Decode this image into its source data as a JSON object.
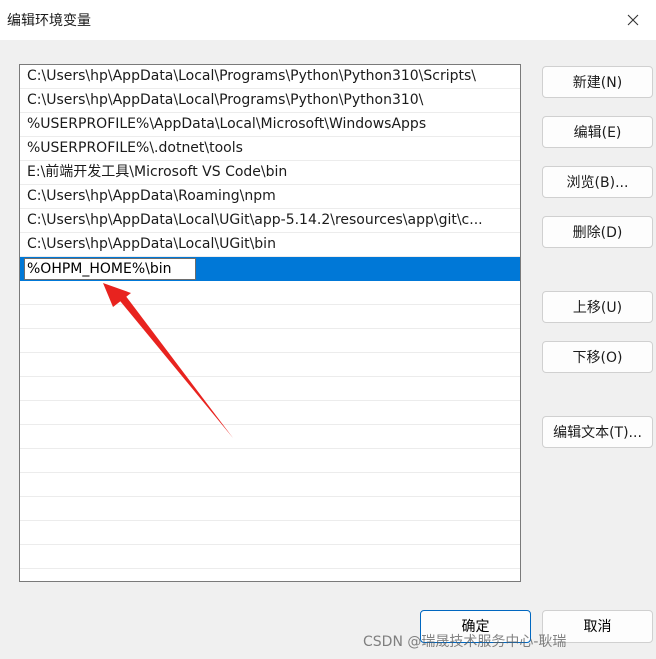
{
  "window": {
    "title": "编辑环境变量"
  },
  "list": {
    "items": [
      "C:\\Users\\hp\\AppData\\Local\\Programs\\Python\\Python310\\Scripts\\",
      "C:\\Users\\hp\\AppData\\Local\\Programs\\Python\\Python310\\",
      "%USERPROFILE%\\AppData\\Local\\Microsoft\\WindowsApps",
      "%USERPROFILE%\\.dotnet\\tools",
      "E:\\前端开发工具\\Microsoft VS Code\\bin",
      "C:\\Users\\hp\\AppData\\Roaming\\npm",
      "C:\\Users\\hp\\AppData\\Local\\UGit\\app-5.14.2\\resources\\app\\git\\c...",
      "C:\\Users\\hp\\AppData\\Local\\UGit\\bin"
    ],
    "editing_value": "%OHPM_HOME%\\bin"
  },
  "buttons": {
    "new": "新建(N)",
    "edit": "编辑(E)",
    "browse": "浏览(B)...",
    "delete": "删除(D)",
    "move_up": "上移(U)",
    "move_down": "下移(O)",
    "edit_text": "编辑文本(T)...",
    "ok": "确定",
    "cancel": "取消"
  },
  "watermark": "CSDN @瑞晟技术服务中心-耿瑞",
  "colors": {
    "selection": "#0078d7",
    "annotation_arrow": "#e8231f",
    "primary_border": "#0067c0"
  }
}
